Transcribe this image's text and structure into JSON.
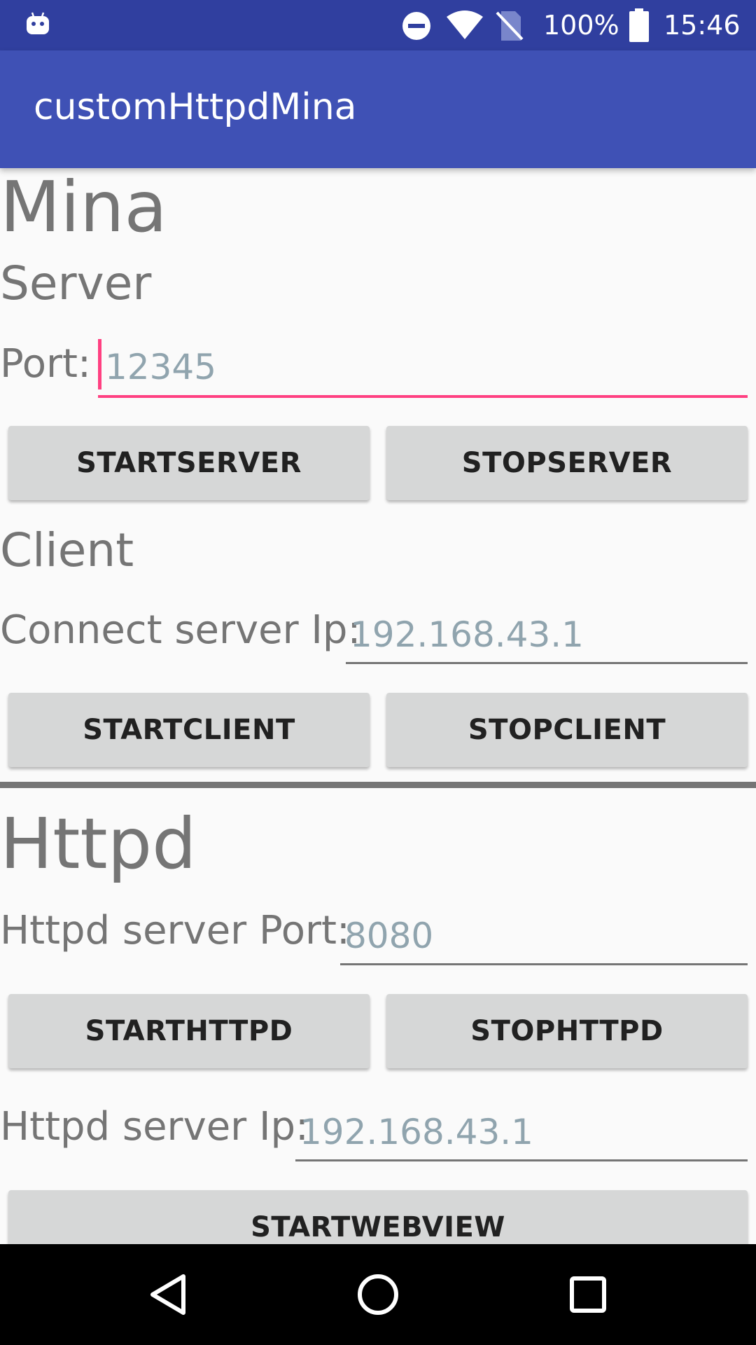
{
  "status_bar": {
    "battery_percent": "100%",
    "time": "15:46",
    "icons": [
      "android-debug-icon",
      "do-not-disturb-icon",
      "wifi-icon",
      "no-sim-icon",
      "battery-icon"
    ]
  },
  "app_bar": {
    "title": "customHttpdMina"
  },
  "mina": {
    "title": "Mina",
    "server": {
      "heading": "Server",
      "port_label": "Port:",
      "port_hint": "12345",
      "start_label": "STARTSERVER",
      "stop_label": "STOPSERVER"
    },
    "client": {
      "heading": "Client",
      "ip_label": "Connect server Ip:",
      "ip_hint": "192.168.43.1",
      "start_label": "STARTCLIENT",
      "stop_label": "STOPCLIENT"
    }
  },
  "httpd": {
    "title": "Httpd",
    "port_label": "Httpd server Port:",
    "port_hint": "8080",
    "start_label": "STARTHTTPD",
    "stop_label": "STOPHTTPD",
    "ip_label": "Httpd server Ip:",
    "ip_hint": "192.168.43.1",
    "webview_label": "STARTWEBVIEW"
  },
  "nav_bar": {
    "icons": [
      "back-icon",
      "home-icon",
      "recents-icon"
    ]
  },
  "colors": {
    "status_bar": "#303f9f",
    "app_bar": "#3f51b5",
    "accent": "#ff4081",
    "text_secondary": "#757575",
    "hint": "#90a4ae",
    "button": "#d6d7d7"
  }
}
